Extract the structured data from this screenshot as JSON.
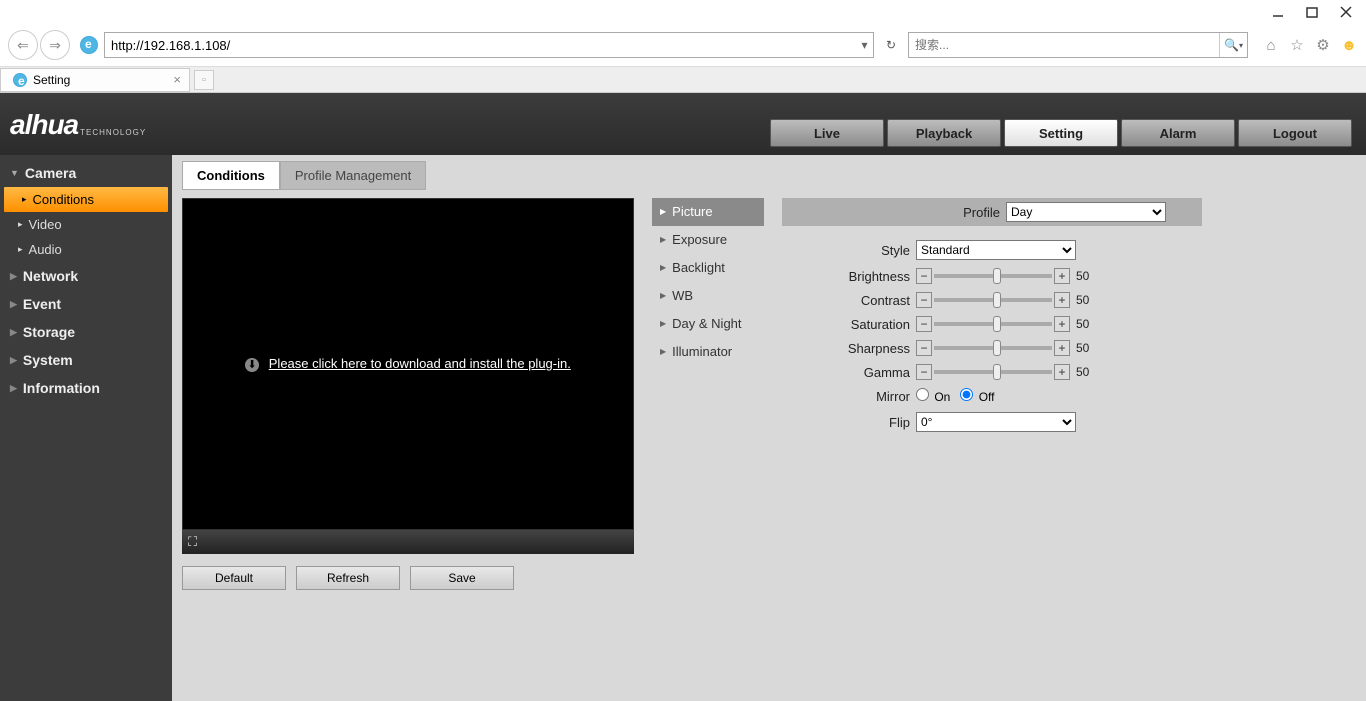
{
  "browser": {
    "url": "http://192.168.1.108/",
    "search_placeholder": "搜索...",
    "tab_title": "Setting"
  },
  "logo": {
    "main": "alhua",
    "sub": "TECHNOLOGY"
  },
  "top_nav": [
    {
      "label": "Live",
      "active": false
    },
    {
      "label": "Playback",
      "active": false
    },
    {
      "label": "Setting",
      "active": true
    },
    {
      "label": "Alarm",
      "active": false
    },
    {
      "label": "Logout",
      "active": false
    }
  ],
  "sidebar": [
    {
      "label": "Camera",
      "open": true,
      "items": [
        {
          "label": "Conditions",
          "active": true
        },
        {
          "label": "Video",
          "active": false
        },
        {
          "label": "Audio",
          "active": false
        }
      ]
    },
    {
      "label": "Network",
      "open": false
    },
    {
      "label": "Event",
      "open": false
    },
    {
      "label": "Storage",
      "open": false
    },
    {
      "label": "System",
      "open": false
    },
    {
      "label": "Information",
      "open": false
    }
  ],
  "sub_tabs": [
    {
      "label": "Conditions",
      "active": true
    },
    {
      "label": "Profile Management",
      "active": false
    }
  ],
  "video_prompt": "Please click here to download and install the plug-in.",
  "actions": {
    "default": "Default",
    "refresh": "Refresh",
    "save": "Save"
  },
  "tree": [
    {
      "label": "Picture",
      "active": true
    },
    {
      "label": "Exposure",
      "active": false
    },
    {
      "label": "Backlight",
      "active": false
    },
    {
      "label": "WB",
      "active": false
    },
    {
      "label": "Day & Night",
      "active": false
    },
    {
      "label": "Illuminator",
      "active": false
    }
  ],
  "profile": {
    "label": "Profile",
    "value": "Day"
  },
  "controls": {
    "style": {
      "label": "Style",
      "value": "Standard"
    },
    "sliders": [
      {
        "label": "Brightness",
        "value": 50
      },
      {
        "label": "Contrast",
        "value": 50
      },
      {
        "label": "Saturation",
        "value": 50
      },
      {
        "label": "Sharpness",
        "value": 50
      },
      {
        "label": "Gamma",
        "value": 50
      }
    ],
    "mirror": {
      "label": "Mirror",
      "on": "On",
      "off": "Off",
      "value": "off"
    },
    "flip": {
      "label": "Flip",
      "value": "0°"
    }
  }
}
